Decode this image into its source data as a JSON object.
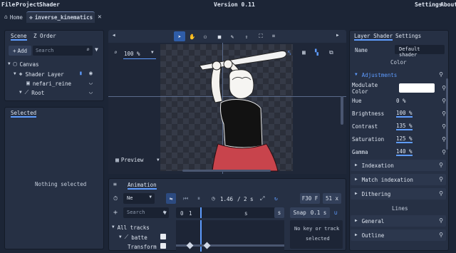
{
  "menubar": {
    "items": [
      "File",
      "Project",
      "Shader"
    ],
    "version": "Version 0.11",
    "right": [
      "Settings",
      "About"
    ]
  },
  "tabs": [
    {
      "label": "Home",
      "icon": "home-icon"
    },
    {
      "label": "inverse_kinematics",
      "icon": "puzzle-icon"
    }
  ],
  "scene_panel": {
    "tabs": [
      "Scene",
      "Z Order"
    ],
    "add_label": "Add",
    "search_placeholder": "Search",
    "tree": [
      {
        "label": "Canvas",
        "icon": "canvas-icon"
      },
      {
        "label": "Shader Layer",
        "icon": "layers-icon"
      },
      {
        "label": "nefari_reine",
        "icon": "image-icon"
      },
      {
        "label": "Root",
        "icon": "bone-icon"
      }
    ]
  },
  "selected_panel": {
    "title": "Selected",
    "empty_text": "Nothing selected"
  },
  "viewport": {
    "zoom": "100 %",
    "preview_label": "Preview"
  },
  "animation": {
    "tab": "Animation",
    "animation_name": "Ne",
    "time": "1.46",
    "duration": "/ 2 s",
    "fps": "F30 F",
    "frame_count": "51 x",
    "search_placeholder": "Search",
    "ruler": [
      "0",
      "1",
      "s",
      "s"
    ],
    "snap_label": "Snap",
    "snap_value": "0.1 s",
    "tracks": [
      {
        "label": "All tracks"
      },
      {
        "label": "batte"
      },
      {
        "label": "Transform"
      }
    ],
    "no_key_text_1": "No key or track",
    "no_key_text_2": "selected"
  },
  "inspector": {
    "tabs": [
      "Layer Shader",
      "Settings"
    ],
    "name_label": "Name",
    "name_value": "Default shader",
    "color_section": "Color",
    "adjustments_label": "Adjustments",
    "props": [
      {
        "label": "Modulate Color",
        "value": ""
      },
      {
        "label": "Hue",
        "value": "0 %"
      },
      {
        "label": "Brightness",
        "value": "100 %"
      },
      {
        "label": "Contrast",
        "value": "135 %"
      },
      {
        "label": "Saturation",
        "value": "125 %"
      },
      {
        "label": "Gamma",
        "value": "140 %"
      }
    ],
    "sections": [
      "Indexation",
      "Match indexation",
      "Dithering"
    ],
    "lines_section": "Lines",
    "line_sections": [
      "General",
      "Outline"
    ]
  },
  "colors": {
    "accent": "#5e9cff",
    "skirt": "#c8444c",
    "modulate": "#ffffff"
  }
}
